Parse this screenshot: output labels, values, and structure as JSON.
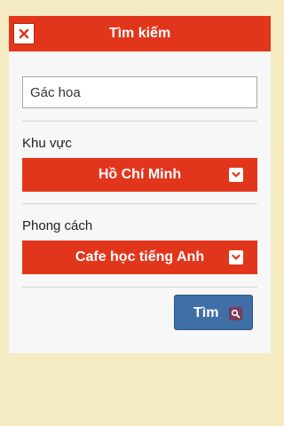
{
  "header": {
    "title": "Tìm kiếm",
    "close_icon": "close-icon"
  },
  "search": {
    "value": "Gác hoa"
  },
  "region": {
    "label": "Khu vực",
    "selected": "Hồ Chí Minh",
    "icon": "chevron-down-icon"
  },
  "style": {
    "label": "Phong cách",
    "selected": "Cafe học tiếng Anh",
    "icon": "chevron-down-icon"
  },
  "submit": {
    "label": "Tìm",
    "icon": "search-icon"
  },
  "colors": {
    "background": "#f5ebc3",
    "accent": "#e2361c",
    "button": "#3f6fa6",
    "panel": "#f7f7f7"
  }
}
